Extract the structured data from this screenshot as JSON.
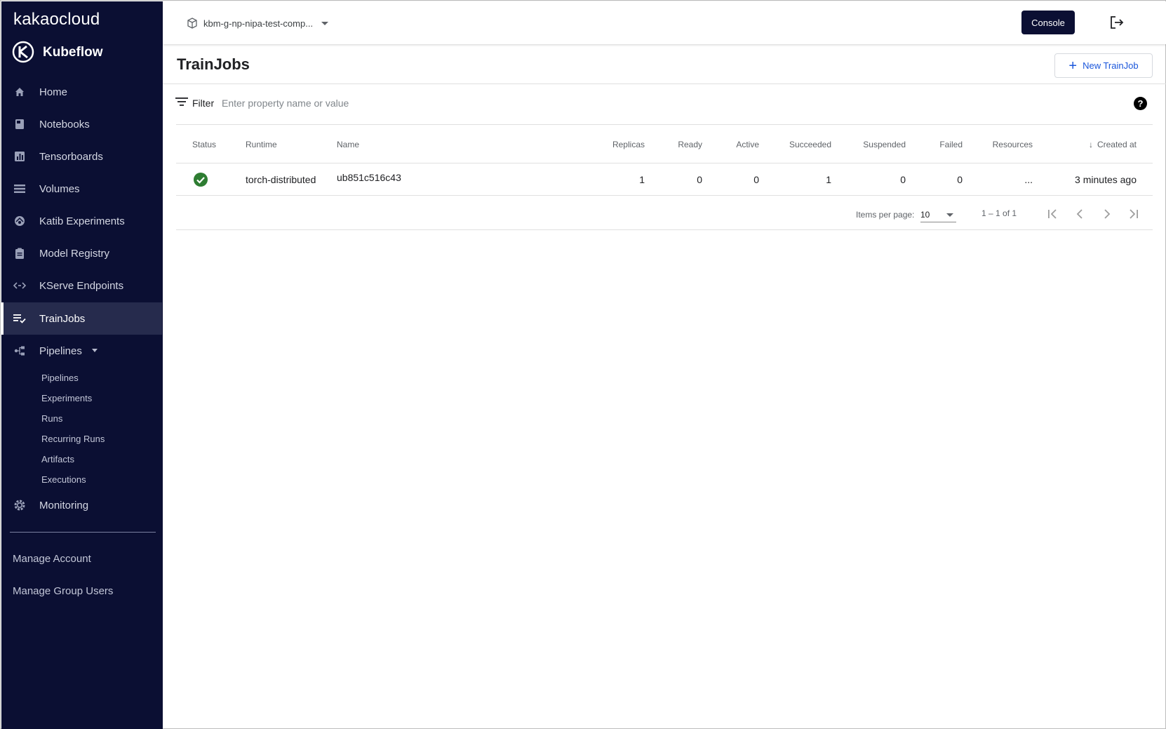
{
  "brand": "kakaocloud",
  "app_name": "Kubeflow",
  "sidebar": {
    "items": [
      {
        "label": "Home",
        "icon": "home-icon"
      },
      {
        "label": "Notebooks",
        "icon": "book-icon"
      },
      {
        "label": "Tensorboards",
        "icon": "chart-icon"
      },
      {
        "label": "Volumes",
        "icon": "list-icon"
      },
      {
        "label": "Katib Experiments",
        "icon": "katib-icon"
      },
      {
        "label": "Model Registry",
        "icon": "clipboard-icon"
      },
      {
        "label": "KServe Endpoints",
        "icon": "code-arrows-icon"
      },
      {
        "label": "TrainJobs",
        "icon": "playlist-check-icon",
        "active": true
      },
      {
        "label": "Pipelines",
        "icon": "pipeline-icon"
      },
      {
        "label": "Monitoring",
        "icon": "gear-icon"
      }
    ],
    "pipelines_sub": [
      "Pipelines",
      "Experiments",
      "Runs",
      "Recurring Runs",
      "Artifacts",
      "Executions"
    ],
    "footer_links": [
      "Manage Account",
      "Manage Group Users"
    ]
  },
  "topbar": {
    "namespace": "kbm-g-np-nipa-test-comp...",
    "console_label": "Console"
  },
  "page": {
    "title": "TrainJobs",
    "new_button": "New TrainJob"
  },
  "filter": {
    "label": "Filter",
    "placeholder": "Enter property name or value"
  },
  "table": {
    "columns": [
      "Status",
      "Runtime",
      "Name",
      "Replicas",
      "Ready",
      "Active",
      "Succeeded",
      "Suspended",
      "Failed",
      "Resources",
      "Created at"
    ],
    "rows": [
      {
        "status": "succeeded",
        "runtime": "torch-distributed",
        "name": "ub851c516c43",
        "replicas": "1",
        "ready": "0",
        "active": "0",
        "succeeded": "1",
        "suspended": "0",
        "failed": "0",
        "resources": "...",
        "created_at": "3 minutes ago"
      }
    ]
  },
  "paginator": {
    "items_per_page_label": "Items per page:",
    "items_per_page": "10",
    "range": "1 – 1 of 1"
  },
  "colors": {
    "sidebar_bg": "#0b0f33",
    "sidebar_active": "#262b4d",
    "accent_link": "#1a56db",
    "success": "#2e7d32"
  }
}
